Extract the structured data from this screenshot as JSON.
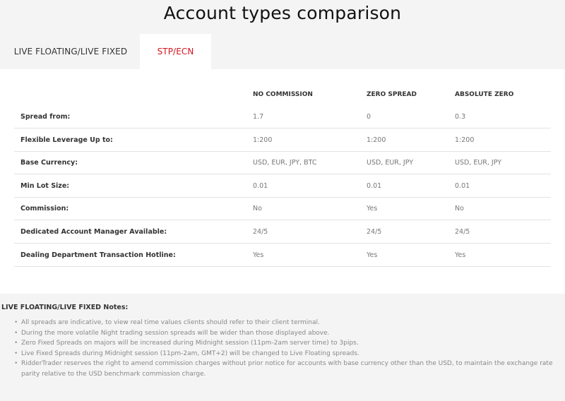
{
  "page": {
    "title": "Account types comparison"
  },
  "tabs": [
    {
      "label": "LIVE FLOATING/LIVE FIXED",
      "active": false
    },
    {
      "label": "STP/ECN",
      "active": true
    }
  ],
  "colors": {
    "accent": "#d4141f",
    "background": "#f4f4f4",
    "panel": "#ffffff"
  },
  "table": {
    "columns": [
      "NO COMMISSION",
      "ZERO SPREAD",
      "ABSOLUTE ZERO"
    ],
    "rows": [
      {
        "label": "Spread from:",
        "values": [
          "1.7",
          "0",
          "0.3"
        ]
      },
      {
        "label": "Flexible Leverage Up to:",
        "values": [
          "1:200",
          "1:200",
          "1:200"
        ]
      },
      {
        "label": "Base Currency:",
        "values": [
          "USD, EUR, JPY, BTC",
          "USD, EUR, JPY",
          "USD, EUR, JPY"
        ]
      },
      {
        "label": "Min Lot Size:",
        "values": [
          "0.01",
          "0.01",
          "0.01"
        ]
      },
      {
        "label": "Commission:",
        "values": [
          "No",
          "Yes",
          "No"
        ]
      },
      {
        "label": "Dedicated Account Manager Available:",
        "values": [
          "24/5",
          "24/5",
          "24/5"
        ]
      },
      {
        "label": "Dealing Department Transaction Hotline:",
        "values": [
          "Yes",
          "Yes",
          "Yes"
        ]
      }
    ]
  },
  "notes": {
    "title": "LIVE FLOATING/LIVE FIXED Notes:",
    "items": [
      "All spreads are indicative, to view real time values clients should refer to their client terminal.",
      "During the more volatile Night trading session spreads will be wider than those displayed above.",
      "Zero Fixed Spreads on majors will be increased during Midnight session (11pm-2am server time) to 3pips.",
      "Live Fixed Spreads during Midnight session (11pm-2am, GMT+2) will be changed to Live Floating spreads.",
      "RidderTrader reserves the right to amend commission charges without prior notice for accounts with base currency other than the USD, to maintain the exchange rate parity relative to the USD benchmark commission charge."
    ]
  }
}
